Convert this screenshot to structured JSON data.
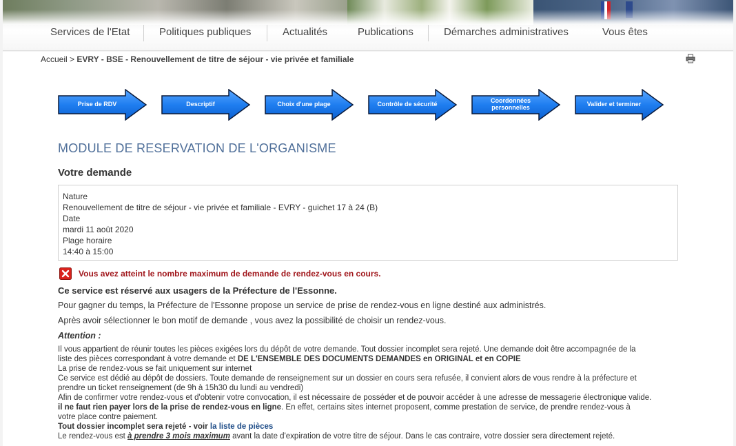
{
  "nav": {
    "items": [
      "Services de l'Etat",
      "Politiques publiques",
      "Actualités",
      "Publications",
      "Démarches administratives",
      "Vous êtes"
    ]
  },
  "breadcrumb": {
    "home": "Accueil",
    "separator": ">",
    "current": "EVRY - BSE - Renouvellement de titre de séjour - vie privée et familiale"
  },
  "steps": [
    "Prise de RDV",
    "Descriptif",
    "Choix d'une plage",
    "Contrôle de sécurité",
    "Coordonnées personnelles",
    "Valider et terminer"
  ],
  "colors": {
    "step_arrow": "#1f7ef0",
    "step_arrow_border": "#0a1a3a",
    "module_title": "#4f6f99",
    "error_text": "#a0161b",
    "error_icon": "#d9221c",
    "link": "#1f4d88"
  },
  "module_title": "MODULE DE RESERVATION DE L'ORGANISME",
  "section_title": "Votre demande",
  "request": {
    "nature_label": "Nature",
    "nature_value": "Renouvellement de titre de séjour - vie privée et familiale - EVRY - guichet 17 à 24 (B)",
    "date_label": "Date",
    "date_value": "mardi 11 août 2020",
    "slot_label": "Plage horaire",
    "slot_value": "14:40 à 15:00"
  },
  "error_message": "Vous avez atteint le nombre maximum de demande de rendez-vous en cours.",
  "reserved_text": "Ce service est réservé aux usagers de la Préfecture de l'Essonne.",
  "paragraph1": "Pour gagner du temps, la Préfecture de l'Essonne propose un service de prise de rendez-vous en ligne destiné aux administrés.",
  "paragraph2": "Après avoir sélectionner le bon motif de demande , vous avez la possibilité de choisir un rendez-vous.",
  "attention_label": "Attention  :",
  "notes": {
    "n1a": " Il vous appartient de réunir toutes les pièces exigées lors du dépôt de votre demande. Tout dossier incomplet sera rejeté. Une demande doit être accompagnée de la",
    "n1b": "liste des pièces correspondant à votre demande et ",
    "n1b_bold": "DE L'ENSEMBLE DES DOCUMENTS DEMANDES en ORIGINAL  et en COPIE",
    "n2": "La prise de rendez-vous se fait uniquement sur internet",
    "n3a": "Ce service est dédié au dépôt de dossiers. Toute demande de renseignement sur un dossier en cours sera refusée, il convient alors de vous rendre à la préfecture et",
    "n3b": "prendre un ticket renseignement (de 9h à 15h30 du lundi au vendredi)",
    "n4": "Afin de confirmer votre rendez-vous et d'obtenir votre convocation, il est nécessaire de posséder et de pouvoir accéder à une adresse de messagerie électronique valide.",
    "n5_bold": " il ne faut rien payer lors de la prise de rendez-vous en ligne",
    "n5_rest": ". En effet, certains sites internet proposent, comme prestation de service, de prendre rendez-vous à",
    "n6": "votre place contre paiement.",
    "n7_bold": "Tout dossier incomplet sera rejeté - voir ",
    "n7_link": "la liste de pièces",
    "n8a": "Le rendez-vous est ",
    "n8_emph": "à prendre 3 mois maximum",
    "n8b": " avant la date d'expiration de votre titre de séjour. Dans le cas contraire, votre dossier sera directement rejeté."
  },
  "icons": {
    "print": "printer-icon",
    "error": "error-x-icon"
  }
}
